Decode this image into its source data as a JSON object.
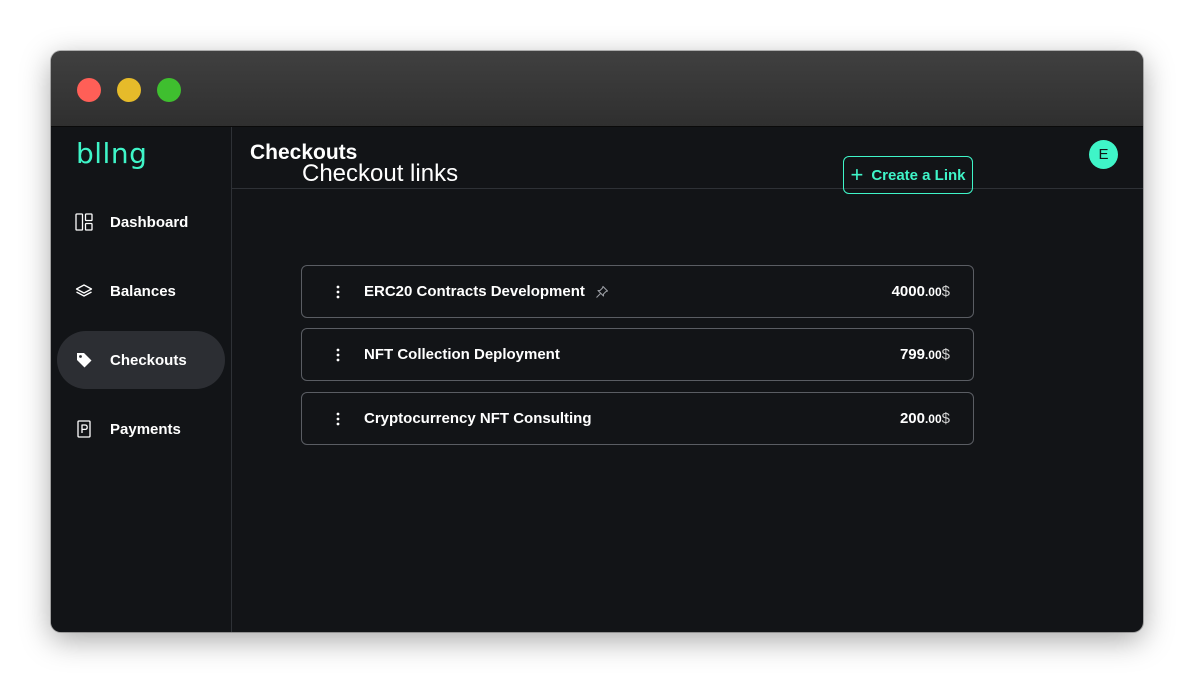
{
  "app": {
    "logo": "bllng",
    "accent_color": "#3ff5c8"
  },
  "sidebar": {
    "items": [
      {
        "label": "Dashboard",
        "icon": "dashboard-icon"
      },
      {
        "label": "Balances",
        "icon": "layers-icon"
      },
      {
        "label": "Checkouts",
        "icon": "tag-icon",
        "active": true
      },
      {
        "label": "Payments",
        "icon": "parking-icon"
      }
    ]
  },
  "header": {
    "title": "Checkouts",
    "avatar_initial": "E"
  },
  "main": {
    "section_title": "Checkout links",
    "create_button_label": "Create a Link",
    "links": [
      {
        "name": "ERC20 Contracts Development",
        "amount_whole": "4000",
        "amount_cents": ".00",
        "currency": "$",
        "pinned": true
      },
      {
        "name": "NFT Collection Deployment",
        "amount_whole": "799",
        "amount_cents": ".00",
        "currency": "$"
      },
      {
        "name": "Cryptocurrency NFT Consulting",
        "amount_whole": "200",
        "amount_cents": ".00",
        "currency": "$"
      }
    ]
  }
}
